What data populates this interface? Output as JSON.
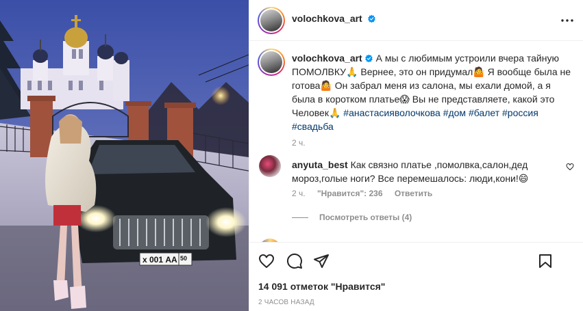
{
  "post": {
    "photo": {
      "plate_text": "х 001 АА",
      "plate_region": "50"
    },
    "author": {
      "username": "volochkova_art",
      "verified": true
    },
    "header": {
      "more_icon": "more-horizontal-icon"
    },
    "caption": {
      "username": "volochkova_art",
      "lines": [
        "А мы с любимым устроили вчера тайную",
        "ПОМОЛВКУ🙏 Вернее, это он придумал🤷 Я вообще была не",
        "готова🤷 Он забрал меня из салона, мы ехали домой, а я",
        "была в коротком платье😱 Вы не представляете, какой это",
        "Человек🙏"
      ],
      "tags_inline": "#анастасияволочкова #дом #балет #россия",
      "tags_last": "#свадьба",
      "time": "2 ч."
    },
    "comments": [
      {
        "username": "anyuta_best",
        "text_line1": "Как связно платье ,помолвка,салон,дед",
        "text_line2": "мороз,голые ноги? Все перемешалось: люди,кони!😄",
        "time": "2 ч.",
        "likes": "\"Нравится\": 236",
        "reply_label": "Ответить"
      }
    ],
    "view_replies": "Посмотреть ответы (4)",
    "actions": {
      "like_icon": "heart-icon",
      "comment_icon": "comment-icon",
      "share_icon": "paper-plane-icon",
      "save_icon": "bookmark-icon"
    },
    "likes_text": "14 091 отметок \"Нравится\"",
    "timestamp": "2 ЧАСОВ НАЗАД"
  },
  "colors": {
    "text": "#262626",
    "secondary": "#8e8e8e",
    "hashtag": "#00376b",
    "verified": "#0095f6",
    "divider": "#efefef"
  }
}
